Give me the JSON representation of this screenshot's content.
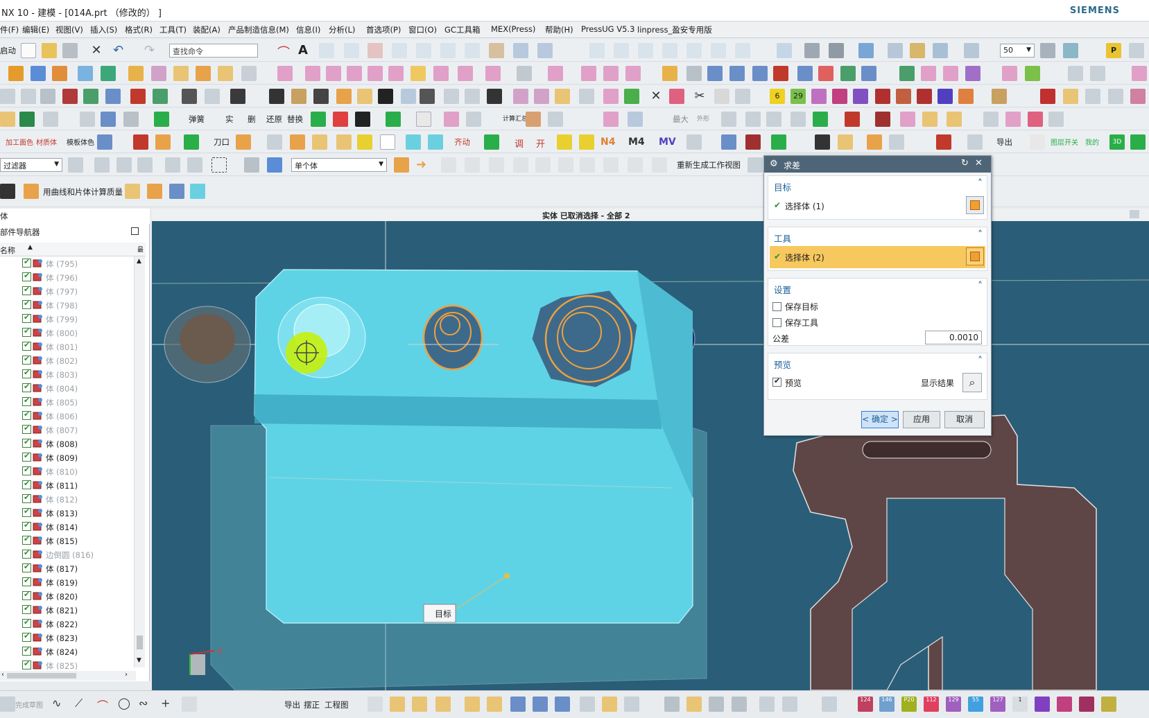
{
  "titlebar": {
    "title": "NX 10 - 建模 - [014A.prt （修改的） ]",
    "brand": "SIEMENS"
  },
  "menu": [
    "件(F)",
    "编辑(E)",
    "视图(V)",
    "插入(S)",
    "格式(R)",
    "工具(T)",
    "装配(A)",
    "产品制造信息(M)",
    "信息(I)",
    "分析(L)",
    "首选项(P)",
    "窗口(O)",
    "GC工具箱",
    "MEX(Press)",
    "帮助(H)",
    "PressUG V5.3",
    "linpress_盈安专用版"
  ],
  "toolbar": {
    "start": "启动",
    "find_command_placeholder": "查找命令",
    "zoom": "50",
    "row3_labels": [
      "弹簧",
      "实",
      "删",
      "还原",
      "替换",
      "计算汇总",
      "最大",
      "外形"
    ],
    "row4_labels": [
      "加工面色",
      "材质体",
      "模板体色",
      "刀口",
      "齐动",
      "开",
      "调",
      "N4",
      "M4",
      "MV",
      "导出",
      "图层开关",
      "我的"
    ],
    "row5": {
      "filter": "过滤器",
      "select_scope": "单个体",
      "regen": "重新生成工作视图"
    },
    "row6": {
      "mass_label": "用曲线和片体计算质量"
    }
  },
  "navigator": {
    "tab": "体",
    "title": "部件导航器",
    "col_name": "名称",
    "rows": [
      {
        "label": "体 (795)",
        "dim": true
      },
      {
        "label": "体 (796)",
        "dim": true
      },
      {
        "label": "体 (797)",
        "dim": true
      },
      {
        "label": "体 (798)",
        "dim": true
      },
      {
        "label": "体 (799)",
        "dim": true
      },
      {
        "label": "体 (800)",
        "dim": true
      },
      {
        "label": "体 (801)",
        "dim": true
      },
      {
        "label": "体 (802)",
        "dim": true
      },
      {
        "label": "体 (803)",
        "dim": true
      },
      {
        "label": "体 (804)",
        "dim": true
      },
      {
        "label": "体 (805)",
        "dim": true
      },
      {
        "label": "体 (806)",
        "dim": true
      },
      {
        "label": "体 (807)",
        "dim": true
      },
      {
        "label": "体 (808)",
        "dim": false
      },
      {
        "label": "体 (809)",
        "dim": false
      },
      {
        "label": "体 (810)",
        "dim": true
      },
      {
        "label": "体 (811)",
        "dim": false
      },
      {
        "label": "体 (812)",
        "dim": true
      },
      {
        "label": "体 (813)",
        "dim": false
      },
      {
        "label": "体 (814)",
        "dim": false
      },
      {
        "label": "体 (815)",
        "dim": false
      },
      {
        "label": "边倒圆 (816)",
        "dim": true
      },
      {
        "label": "体 (817)",
        "dim": false
      },
      {
        "label": "体 (819)",
        "dim": false
      },
      {
        "label": "体 (820)",
        "dim": false
      },
      {
        "label": "体 (821)",
        "dim": false
      },
      {
        "label": "体 (822)",
        "dim": false
      },
      {
        "label": "体 (823)",
        "dim": false
      },
      {
        "label": "体 (824)",
        "dim": false
      },
      {
        "label": "体 (825)",
        "dim": true
      }
    ]
  },
  "viewport": {
    "status": "实体 已取消选择 - 全部 2",
    "target_tag": "目标",
    "axis_x": "X"
  },
  "dialog": {
    "title": "求差",
    "target": {
      "header": "目标",
      "select": "选择体 (1)"
    },
    "tool": {
      "header": "工具",
      "select": "选择体 (2)"
    },
    "settings": {
      "header": "设置",
      "keep_target": "保存目标",
      "keep_tool": "保存工具",
      "tolerance_label": "公差",
      "tolerance_value": "0.0010"
    },
    "preview": {
      "header": "预览",
      "preview_label": "预览",
      "show_result": "显示结果"
    },
    "ok": "< 确定 >",
    "apply": "应用",
    "cancel": "取消"
  },
  "statusbar": {
    "labels": [
      "完成草图",
      "导出",
      "摆正",
      "工程图"
    ],
    "badges": [
      "124",
      "146",
      "P20",
      "112",
      "129",
      "55",
      "127",
      "1"
    ]
  },
  "colors": {
    "viewport": "#2a5e78",
    "part": "#5fd3e6",
    "selection_yellow": "#f7c85e",
    "dialog_header": "#4e6577",
    "accent_blue": "#1b5f99"
  }
}
